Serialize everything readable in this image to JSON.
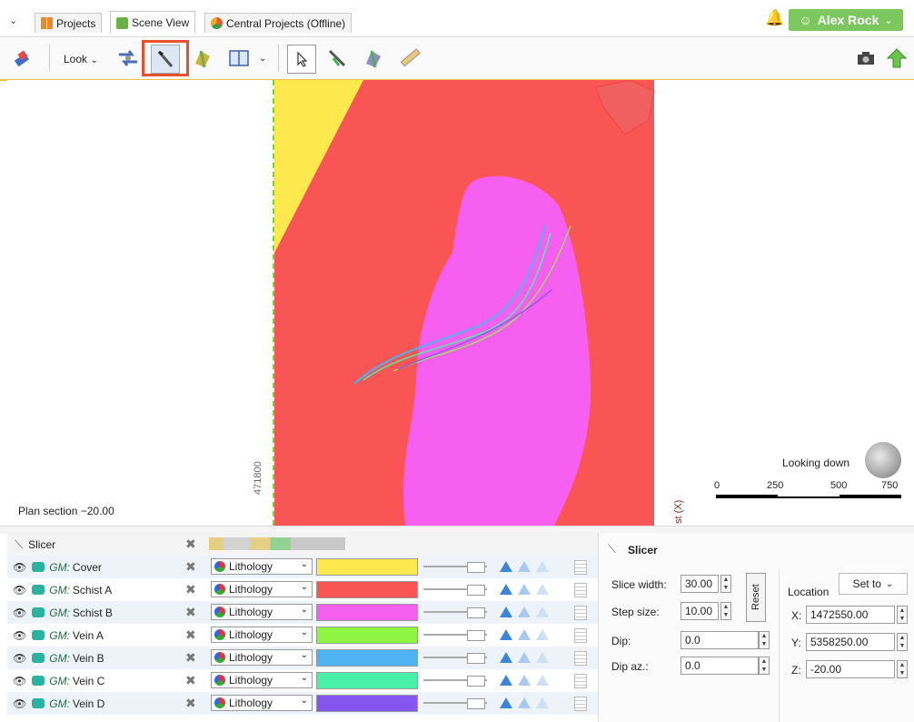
{
  "tabs": [
    {
      "label": "Projects",
      "icon": "projects-icon",
      "active": false
    },
    {
      "label": "Scene View",
      "icon": "scene-icon",
      "active": true
    },
    {
      "label": "Central Projects (Offline)",
      "icon": "central-icon",
      "active": false
    }
  ],
  "user": {
    "name": "Alex Rock"
  },
  "toolbar": {
    "look_label": "Look"
  },
  "viewport": {
    "plan_label": "Plan section −20.00",
    "looking_label": "Looking down",
    "axis_label_left": "471800",
    "axis_label_right": "st (X)",
    "scale": {
      "ticks": [
        "0",
        "250",
        "500",
        "750"
      ]
    }
  },
  "slicer_table": {
    "header": "Slicer",
    "rows": [
      {
        "prefix": "GM:",
        "name": "Cover",
        "lithology": "Lithology",
        "color": "#fde84e"
      },
      {
        "prefix": "GM:",
        "name": "Schist A",
        "lithology": "Lithology",
        "color": "#fa5555"
      },
      {
        "prefix": "GM:",
        "name": "Schist B",
        "lithology": "Lithology",
        "color": "#f75ff1"
      },
      {
        "prefix": "GM:",
        "name": "Vein A",
        "lithology": "Lithology",
        "color": "#8ef543"
      },
      {
        "prefix": "GM:",
        "name": "Vein B",
        "lithology": "Lithology",
        "color": "#4fb2f2"
      },
      {
        "prefix": "GM:",
        "name": "Vein C",
        "lithology": "Lithology",
        "color": "#48f0a8"
      },
      {
        "prefix": "GM:",
        "name": "Vein D",
        "lithology": "Lithology",
        "color": "#8556ef"
      }
    ]
  },
  "props": {
    "title": "Slicer",
    "slice_width_label": "Slice width:",
    "slice_width": "30.00",
    "step_size_label": "Step size:",
    "step_size": "10.00",
    "dip_label": "Dip:",
    "dip": "0.0",
    "dip_az_label": "Dip az.:",
    "dip_az": "0.0",
    "reset_label": "Reset",
    "location_label": "Location",
    "set_to_label": "Set to",
    "x_label": "X:",
    "x_value": "1472550.00",
    "y_label": "Y:",
    "y_value": "5358250.00",
    "z_label": "Z:",
    "z_value": "-20.00"
  }
}
